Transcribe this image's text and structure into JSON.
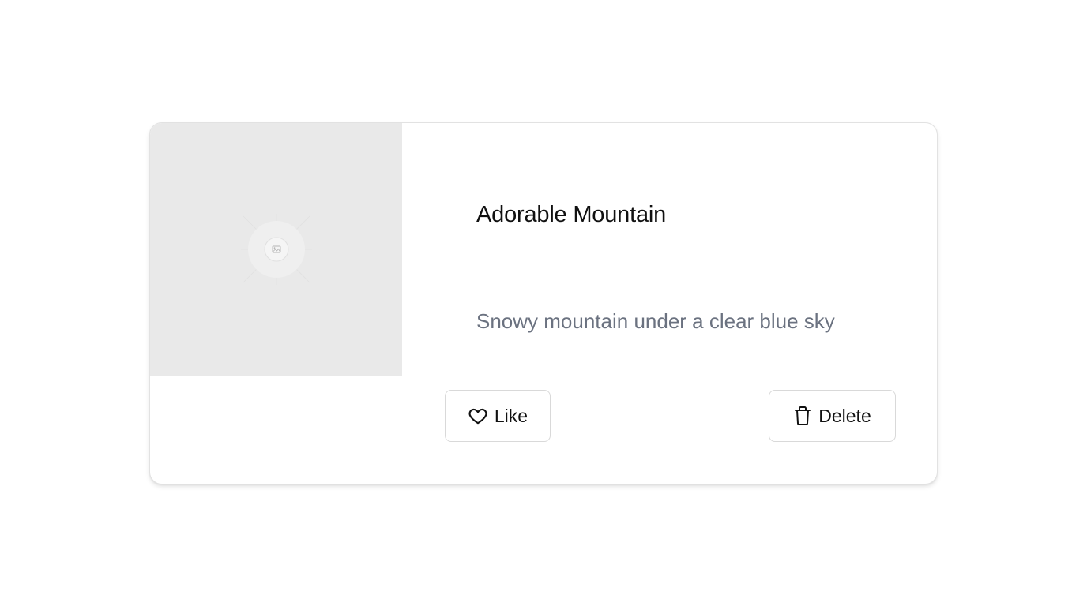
{
  "card": {
    "title": "Adorable Mountain",
    "description": "Snowy mountain under a clear blue sky",
    "image_icon": "image-placeholder-icon",
    "actions": {
      "like_label": "Like",
      "like_icon": "heart-icon",
      "delete_label": "Delete",
      "delete_icon": "trash-icon"
    }
  },
  "colors": {
    "title": "#111111",
    "description": "#6b7280",
    "image_placeholder_bg": "#e9e9e9",
    "border": "#d9d9d9"
  }
}
